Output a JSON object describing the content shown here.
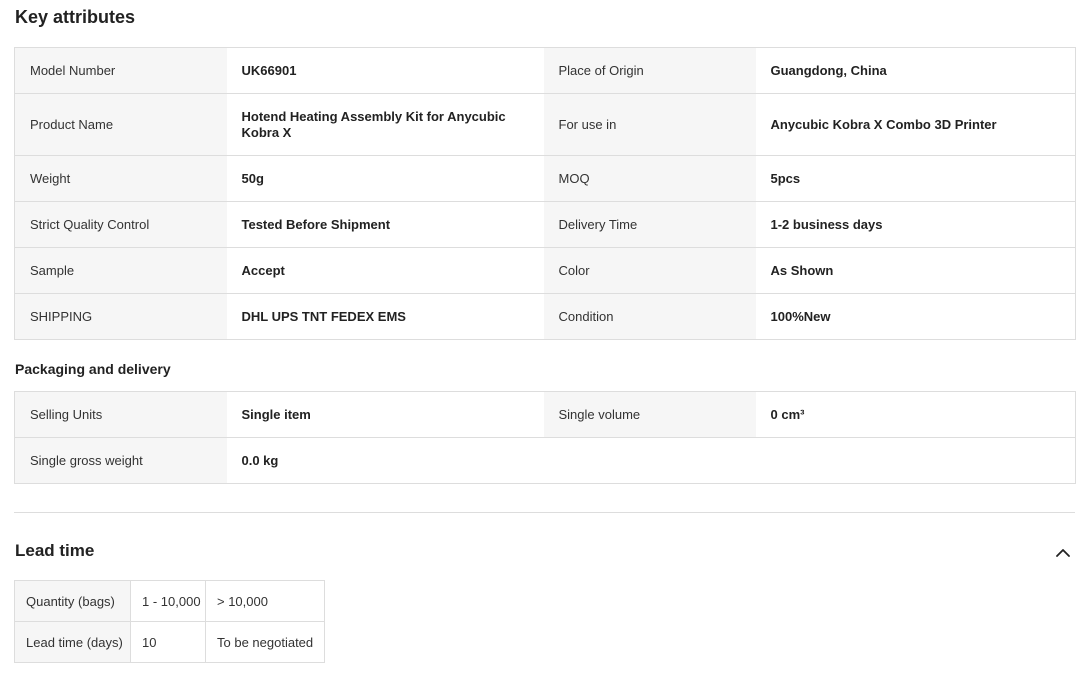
{
  "key_attributes": {
    "title": "Key attributes",
    "rows": [
      [
        "Model Number",
        "UK66901",
        "Place of Origin",
        "Guangdong, China"
      ],
      [
        "Product Name",
        "Hotend Heating Assembly Kit for Anycubic Kobra X",
        "For use in",
        "Anycubic Kobra X Combo 3D Printer"
      ],
      [
        "Weight",
        "50g",
        "MOQ",
        "5pcs"
      ],
      [
        "Strict Quality Control",
        "Tested Before Shipment",
        "Delivery Time",
        "1-2 business days"
      ],
      [
        "Sample",
        "Accept",
        "Color",
        "As Shown"
      ],
      [
        "SHIPPING",
        "DHL UPS TNT FEDEX EMS",
        "Condition",
        "100%New"
      ]
    ]
  },
  "packaging": {
    "title": "Packaging and delivery",
    "rows": [
      [
        "Selling Units",
        "Single item",
        "Single volume",
        "0 cm³"
      ],
      [
        "Single gross weight",
        "0.0 kg",
        "",
        ""
      ]
    ]
  },
  "lead_time": {
    "title": "Lead time",
    "collapse_icon": "chevron-up-icon",
    "rows": [
      [
        "Quantity (bags)",
        "1 - 10,000",
        "> 10,000"
      ],
      [
        "Lead time (days)",
        "10",
        "To be negotiated"
      ]
    ]
  }
}
